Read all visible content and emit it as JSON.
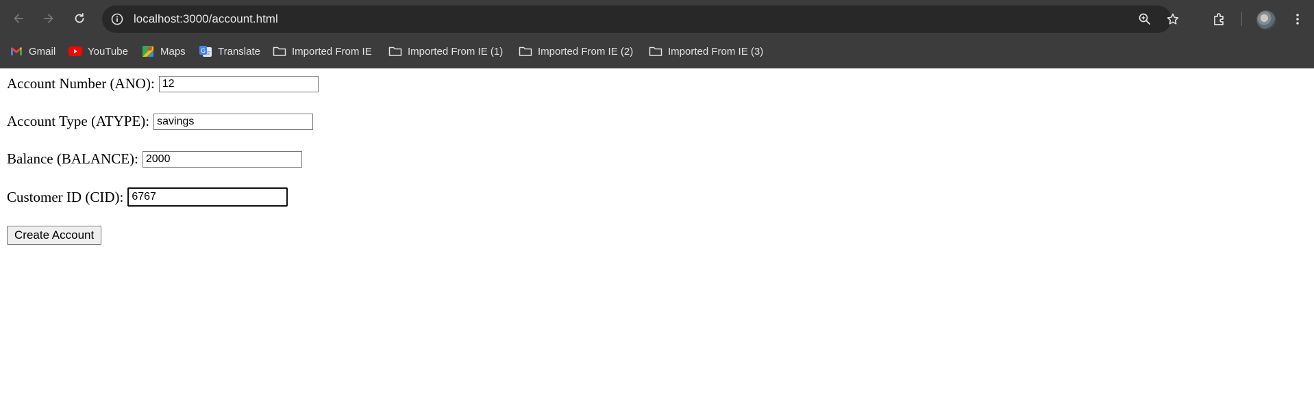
{
  "browser": {
    "url": "localhost:3000/account.html",
    "icons": {
      "back": "arrow-left",
      "forward": "arrow-right",
      "reload": "reload",
      "site_info": "info-circle",
      "zoom": "zoom-in",
      "bookmark": "star",
      "extensions": "puzzle",
      "profile": "avatar",
      "menu": "kebab"
    },
    "bookmarks": [
      {
        "label": "Gmail",
        "icon": "gmail-icon"
      },
      {
        "label": "YouTube",
        "icon": "youtube-icon"
      },
      {
        "label": "Maps",
        "icon": "maps-icon"
      },
      {
        "label": "Translate",
        "icon": "translate-icon"
      },
      {
        "label": "Imported From IE",
        "icon": "folder-icon"
      },
      {
        "label": "Imported From IE (1)",
        "icon": "folder-icon"
      },
      {
        "label": "Imported From IE (2)",
        "icon": "folder-icon"
      },
      {
        "label": "Imported From IE (3)",
        "icon": "folder-icon"
      }
    ]
  },
  "form": {
    "ano_label": "Account Number (ANO):",
    "ano_value": "12",
    "atype_label": "Account Type (ATYPE):",
    "atype_value": "savings",
    "balance_label": "Balance (BALANCE):",
    "balance_value": "2000",
    "cid_label": "Customer ID (CID):",
    "cid_value": "6767",
    "submit_label": "Create Account"
  },
  "colors": {
    "chrome_bg": "#3c3c3c",
    "omnibox_bg": "#282828",
    "page_bg": "#ffffff"
  }
}
